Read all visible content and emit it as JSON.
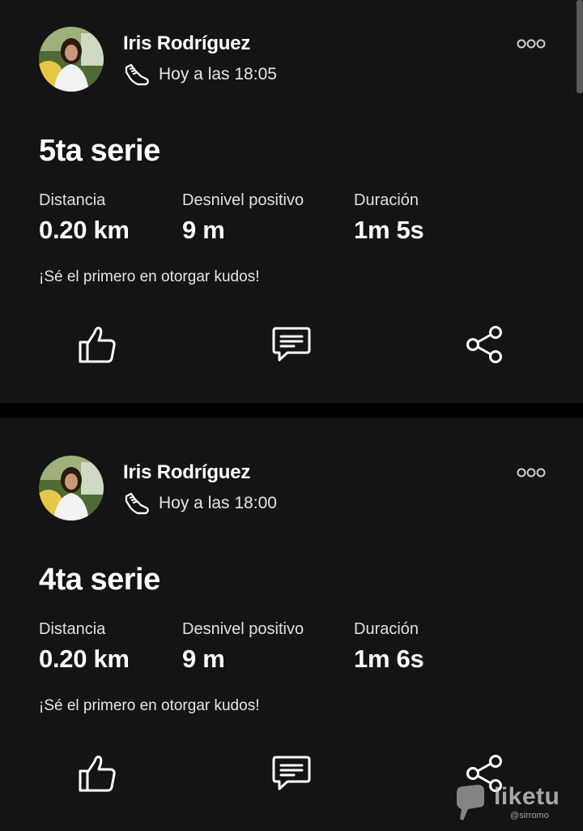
{
  "feed": [
    {
      "athlete": "Iris Rodríguez",
      "timestamp": "Hoy a las 18:05",
      "title": "5ta serie",
      "stats": [
        {
          "label": "Distancia",
          "value": "0.20 km"
        },
        {
          "label": "Desnivel positivo",
          "value": "9 m"
        },
        {
          "label": "Duración",
          "value": "1m 5s"
        }
      ],
      "kudos_prompt": "¡Sé el primero en otorgar kudos!",
      "icons": {
        "activity_type": "shoe-icon",
        "more": "more-icon",
        "kudos": "thumbs-up-icon",
        "comment": "comment-icon",
        "share": "share-icon"
      }
    },
    {
      "athlete": "Iris Rodríguez",
      "timestamp": "Hoy a las 18:00",
      "title": "4ta serie",
      "stats": [
        {
          "label": "Distancia",
          "value": "0.20 km"
        },
        {
          "label": "Desnivel positivo",
          "value": "9 m"
        },
        {
          "label": "Duración",
          "value": "1m 6s"
        }
      ],
      "kudos_prompt": "¡Sé el primero en otorgar kudos!",
      "icons": {
        "activity_type": "shoe-icon",
        "more": "more-icon",
        "kudos": "thumbs-up-icon",
        "comment": "comment-icon",
        "share": "share-icon"
      }
    }
  ],
  "watermark": {
    "brand": "liketu",
    "handle": "@sirromo"
  },
  "colors": {
    "background": "#000000",
    "card": "#141414",
    "text": "#ffffff",
    "muted": "#e0e0e0"
  }
}
